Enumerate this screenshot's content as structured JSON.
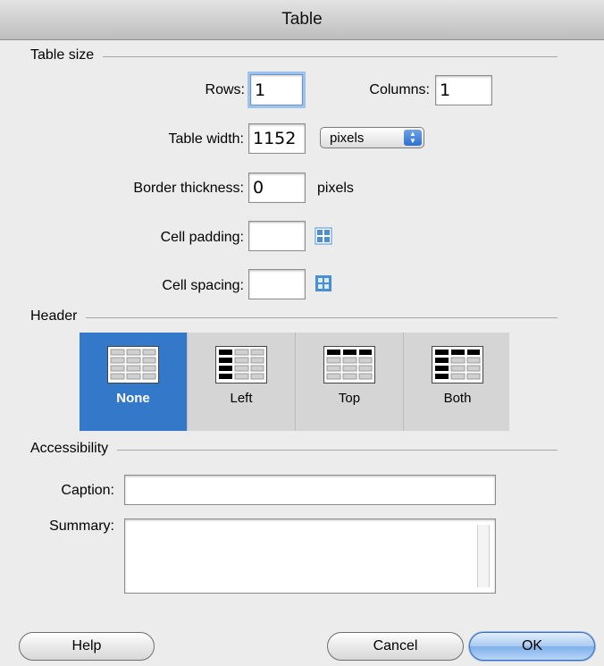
{
  "window": {
    "title": "Table"
  },
  "table_size": {
    "section_label": "Table size",
    "rows_label": "Rows:",
    "rows_value": "1",
    "columns_label": "Columns:",
    "columns_value": "1",
    "width_label": "Table width:",
    "width_value": "1152",
    "width_unit_selected": "pixels",
    "border_label": "Border thickness:",
    "border_value": "0",
    "border_unit": "pixels",
    "padding_label": "Cell padding:",
    "padding_value": "",
    "spacing_label": "Cell spacing:",
    "spacing_value": ""
  },
  "header": {
    "section_label": "Header",
    "selected": "None",
    "options": [
      {
        "label": "None",
        "icon": "header-none-icon"
      },
      {
        "label": "Left",
        "icon": "header-left-icon"
      },
      {
        "label": "Top",
        "icon": "header-top-icon"
      },
      {
        "label": "Both",
        "icon": "header-both-icon"
      }
    ]
  },
  "accessibility": {
    "section_label": "Accessibility",
    "caption_label": "Caption:",
    "caption_value": "",
    "summary_label": "Summary:",
    "summary_value": ""
  },
  "buttons": {
    "help": "Help",
    "cancel": "Cancel",
    "ok": "OK"
  },
  "colors": {
    "selected": "#3478c9",
    "focus_ring": "#9ec2ec",
    "cell_icon": "#4a8fd6"
  }
}
